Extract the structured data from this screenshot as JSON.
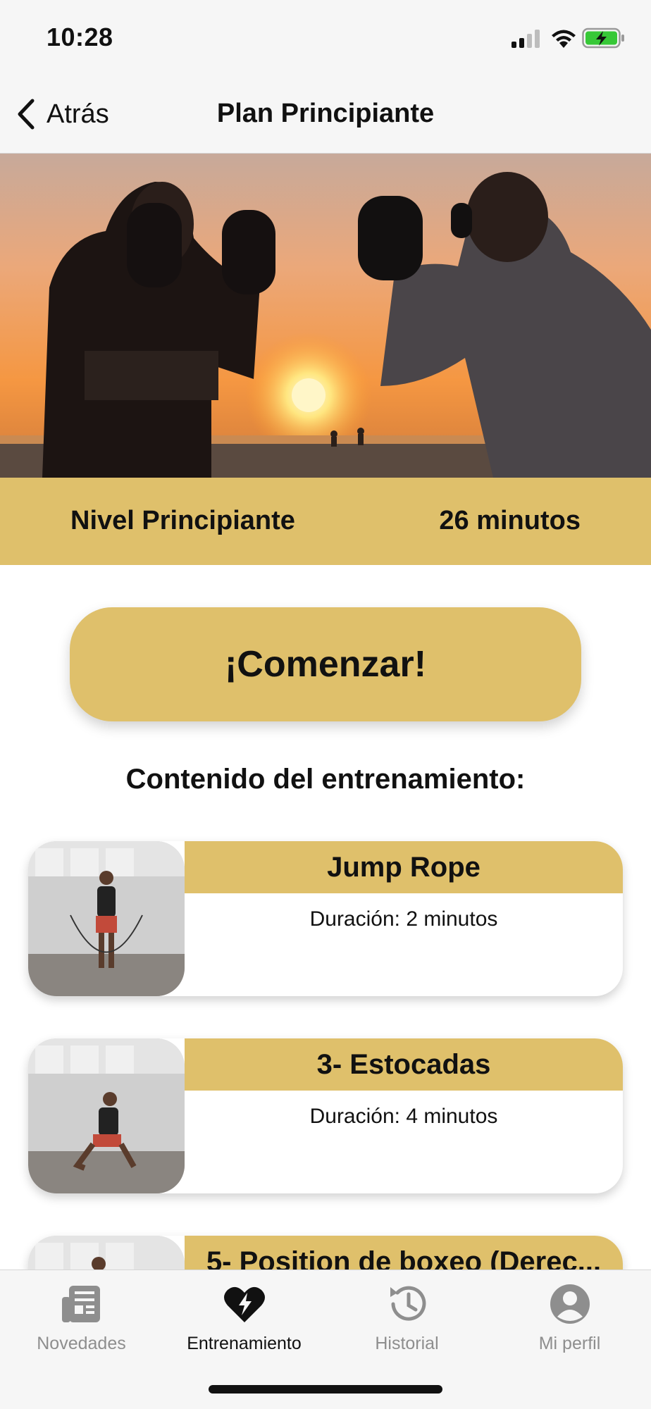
{
  "status_bar": {
    "time": "10:28",
    "battery_color": "#37c837"
  },
  "nav": {
    "back_label": "Atrás",
    "title": "Plan Principiante"
  },
  "hero": {
    "image_description": "Two boxers silhouetted at sunset on a beach"
  },
  "info": {
    "level": "Nivel Principiante",
    "duration": "26 minutos"
  },
  "start_button": {
    "label": "¡Comenzar!"
  },
  "section_title": "Contenido del entrenamiento:",
  "exercises": [
    {
      "title": "Jump Rope",
      "duration": "Duración: 2 minutos"
    },
    {
      "title": "3- Estocadas",
      "duration": "Duración: 4 minutos"
    },
    {
      "title": "5- Position de boxeo (Derec...",
      "duration": ""
    }
  ],
  "tabs": [
    {
      "label": "Novedades",
      "icon": "news-icon",
      "active": false
    },
    {
      "label": "Entrenamiento",
      "icon": "heart-bolt-icon",
      "active": true
    },
    {
      "label": "Historial",
      "icon": "history-icon",
      "active": false
    },
    {
      "label": "Mi perfil",
      "icon": "profile-icon",
      "active": false
    }
  ],
  "colors": {
    "accent": "#dfc06b",
    "background": "#ffffff",
    "bar_background": "#f6f6f6",
    "inactive_tab": "#8e8e8e"
  }
}
